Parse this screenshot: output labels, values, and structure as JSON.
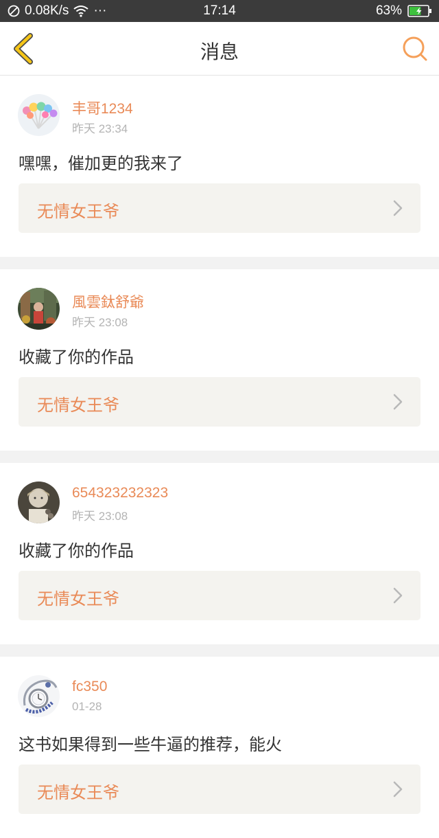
{
  "status_bar": {
    "net_speed": "0.08K/s",
    "more": "···",
    "time": "17:14",
    "battery": "63%",
    "battery_level": 0.63
  },
  "nav": {
    "title": "消息",
    "back_icon": "chevron-left-icon",
    "search_icon": "search-icon",
    "accent_color": "#f5a623"
  },
  "messages": [
    {
      "username": "丰哥1234",
      "time": "昨天 23:34",
      "text": "嘿嘿，催加更的我来了",
      "work_title": "无情女王爷"
    },
    {
      "username": "風雲鈦舒爺",
      "time": "昨天 23:08",
      "text": "收藏了你的作品",
      "work_title": "无情女王爷"
    },
    {
      "username": "654323232323",
      "time": "昨天 23:08",
      "text": "收藏了你的作品",
      "work_title": "无情女王爷"
    },
    {
      "username": "fc350",
      "time": "01-28",
      "text": "这书如果得到一些牛逼的推荐，能火",
      "work_title": "无情女王爷"
    }
  ],
  "colors": {
    "username": "#e98a57",
    "link_bg": "#f4f3ef",
    "divider": "#f2f2f2"
  }
}
